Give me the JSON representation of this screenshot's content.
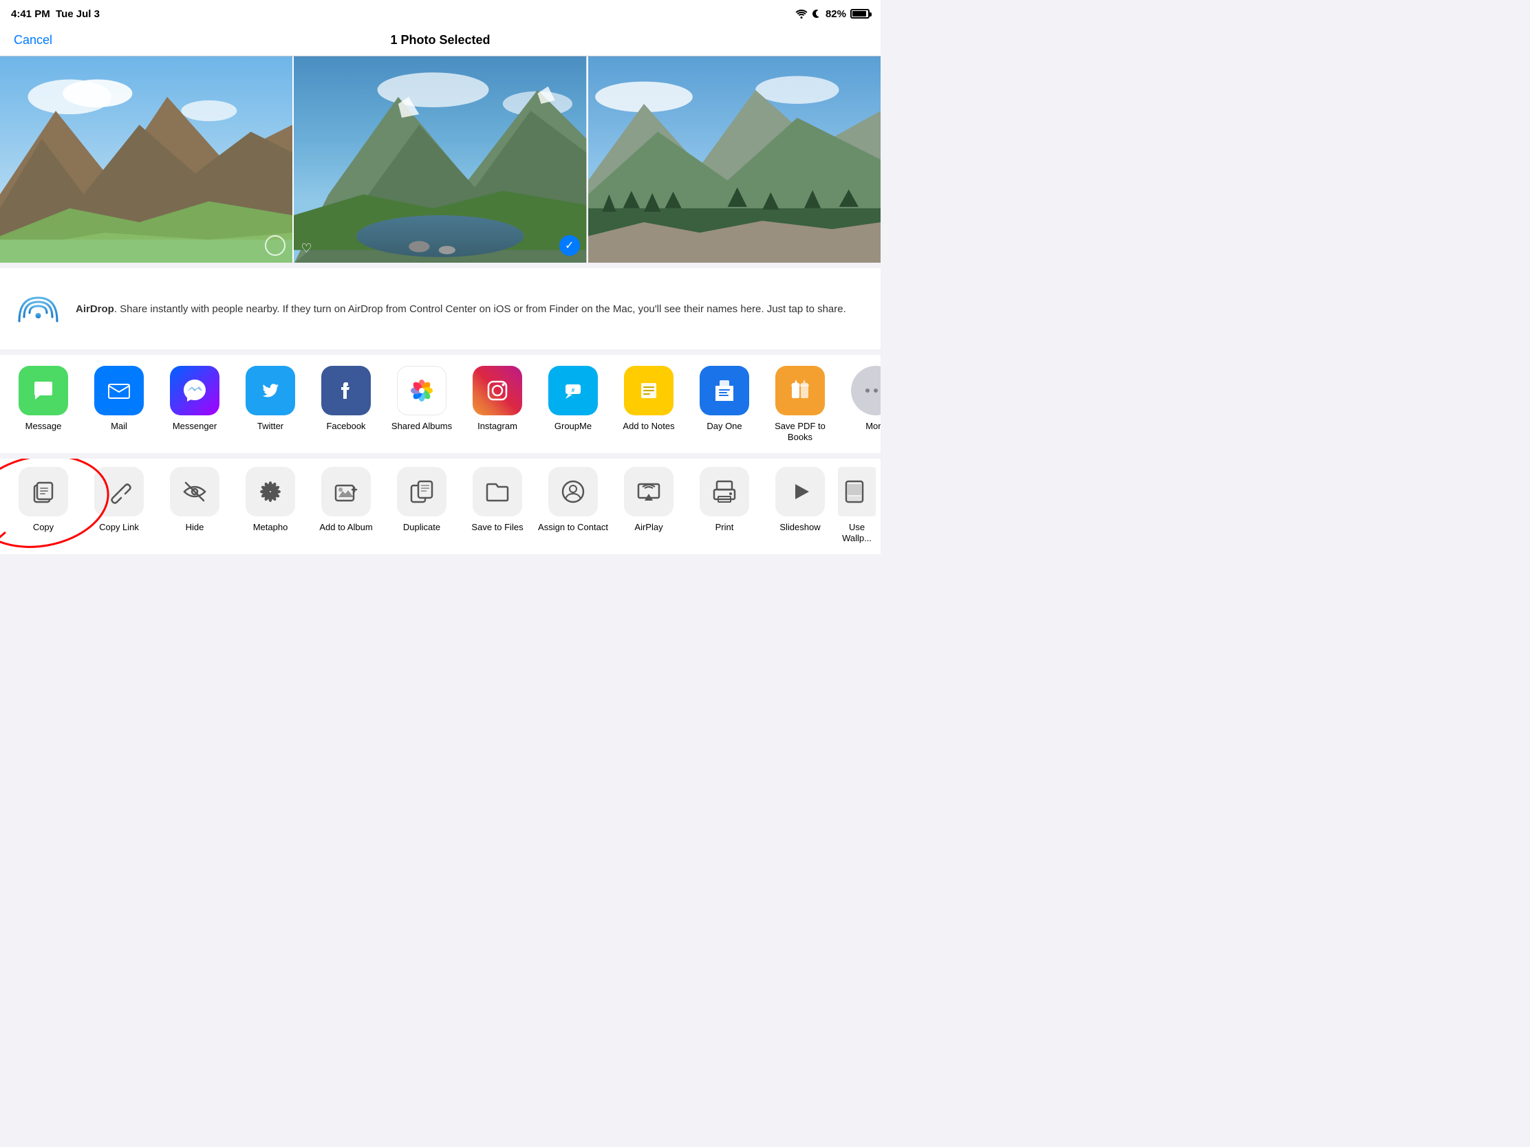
{
  "statusBar": {
    "time": "4:41 PM",
    "date": "Tue Jul 3",
    "battery": "82%"
  },
  "header": {
    "cancel": "Cancel",
    "title": "1 Photo Selected"
  },
  "airdrop": {
    "name": "AirDrop",
    "description": ". Share instantly with people nearby. If they turn on AirDrop from Control Center on iOS or from Finder on the Mac, you'll see their names here. Just tap to share."
  },
  "apps": [
    {
      "id": "message",
      "label": "Message",
      "icon": "💬",
      "bg": "bg-green"
    },
    {
      "id": "mail",
      "label": "Mail",
      "icon": "✉️",
      "bg": "bg-blue"
    },
    {
      "id": "messenger",
      "label": "Messenger",
      "icon": "⚡",
      "bg": "bg-messenger"
    },
    {
      "id": "twitter",
      "label": "Twitter",
      "icon": "🐦",
      "bg": "bg-twitter"
    },
    {
      "id": "facebook",
      "label": "Facebook",
      "icon": "f",
      "bg": "bg-facebook"
    },
    {
      "id": "shared-albums",
      "label": "Shared Albums",
      "icon": "🌸",
      "bg": "bg-photos"
    },
    {
      "id": "instagram",
      "label": "Instagram",
      "icon": "📷",
      "bg": "bg-instagram"
    },
    {
      "id": "groupme",
      "label": "GroupMe",
      "icon": "#",
      "bg": "bg-groupme"
    },
    {
      "id": "add-to-notes",
      "label": "Add to Notes",
      "icon": "📝",
      "bg": "bg-notes"
    },
    {
      "id": "day-one",
      "label": "Day One",
      "icon": "📖",
      "bg": "bg-dayone"
    },
    {
      "id": "save-pdf-to-books",
      "label": "Save PDF to Books",
      "icon": "📚",
      "bg": "bg-books"
    },
    {
      "id": "more",
      "label": "More",
      "icon": "•••",
      "bg": "bg-more"
    }
  ],
  "actions": [
    {
      "id": "copy",
      "label": "Copy",
      "icon": "copy"
    },
    {
      "id": "copy-link",
      "label": "Copy Link",
      "icon": "link"
    },
    {
      "id": "hide",
      "label": "Hide",
      "icon": "hide"
    },
    {
      "id": "metapho",
      "label": "Metapho",
      "icon": "metapho"
    },
    {
      "id": "add-to-album",
      "label": "Add to Album",
      "icon": "add-album"
    },
    {
      "id": "duplicate",
      "label": "Duplicate",
      "icon": "duplicate"
    },
    {
      "id": "save-to-files",
      "label": "Save to Files",
      "icon": "files"
    },
    {
      "id": "assign-to-contact",
      "label": "Assign to Contact",
      "icon": "contact"
    },
    {
      "id": "airplay",
      "label": "AirPlay",
      "icon": "airplay"
    },
    {
      "id": "print",
      "label": "Print",
      "icon": "print"
    },
    {
      "id": "slideshow",
      "label": "Slideshow",
      "icon": "slideshow"
    },
    {
      "id": "use-wallpaper",
      "label": "Use Wallp...",
      "icon": "wallpaper"
    }
  ]
}
